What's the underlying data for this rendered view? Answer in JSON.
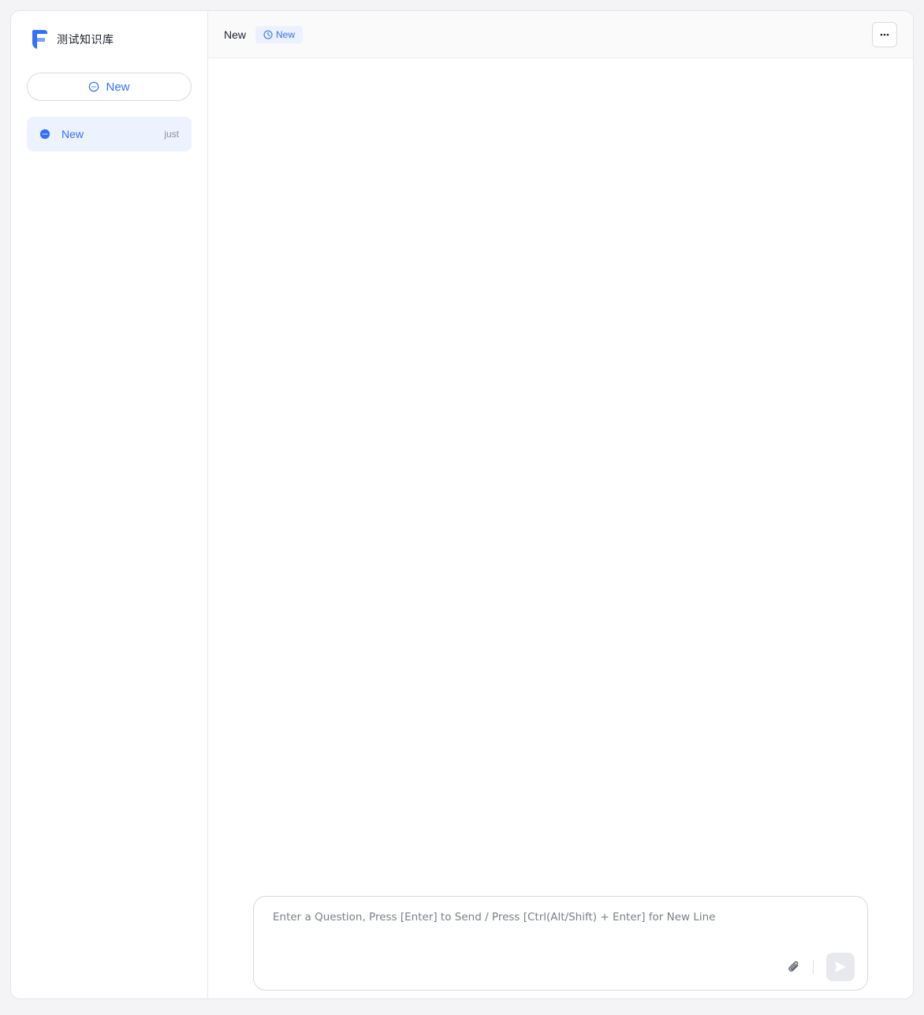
{
  "sidebar": {
    "app_name": "测试知识库",
    "new_button_label": "New",
    "history": [
      {
        "title": "New",
        "time": "just"
      }
    ]
  },
  "header": {
    "title": "New",
    "tag_label": "New",
    "more_icon": "more-dots-icon"
  },
  "composer": {
    "placeholder": "Enter a Question, Press [Enter] to Send / Press [Ctrl(Alt/Shift) + Enter] for New Line",
    "value": "",
    "attach_icon": "paperclip-icon",
    "send_icon": "send-icon"
  },
  "colors": {
    "accent": "#3370ff",
    "active_bg": "#edf2ff",
    "border": "#d7dae0"
  }
}
